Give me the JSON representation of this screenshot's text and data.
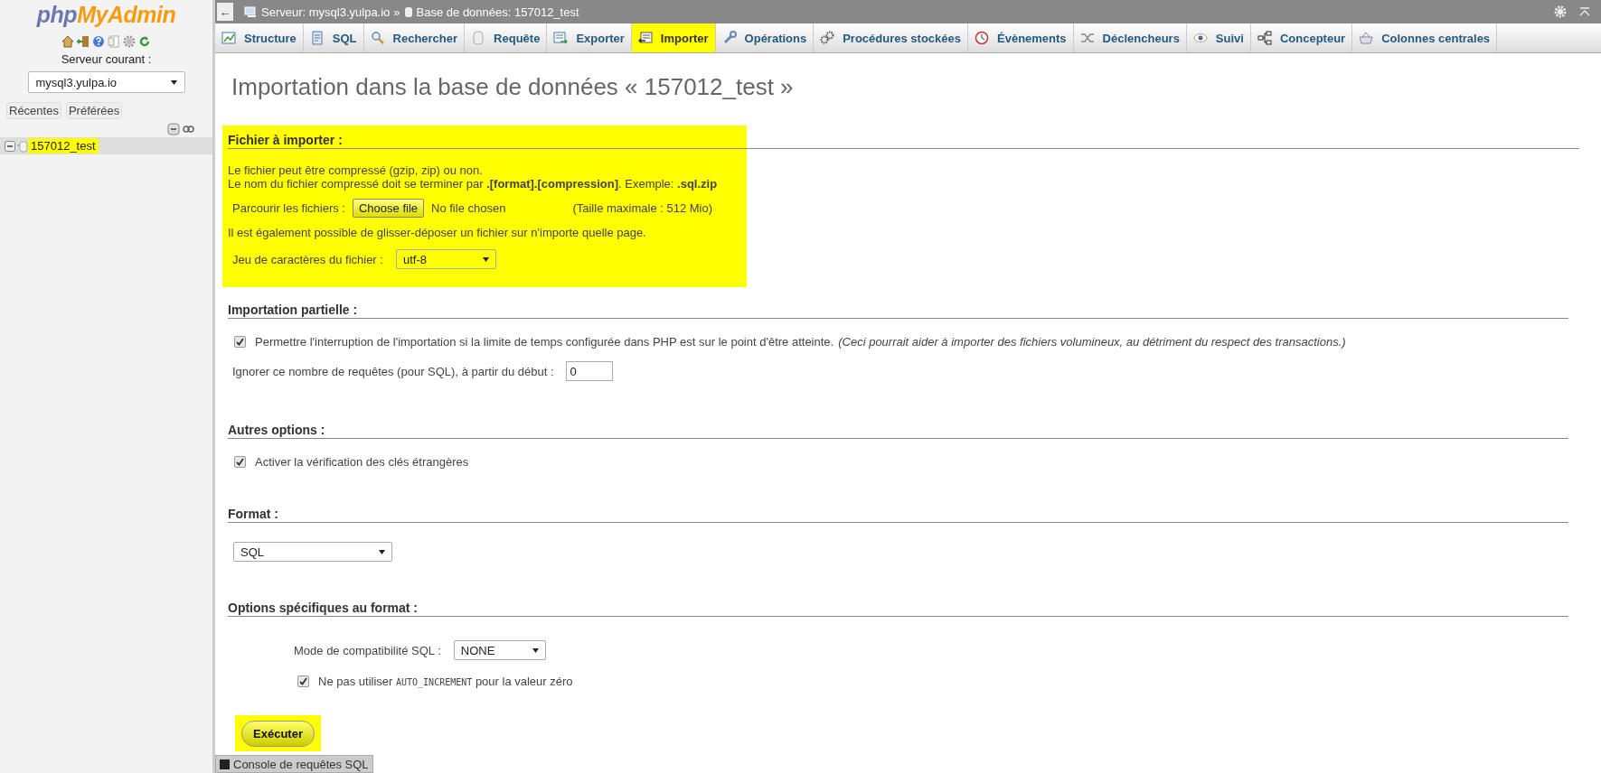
{
  "sidebar": {
    "logo_parts": [
      "php",
      "MyAdmin"
    ],
    "server_label": "Serveur courant :",
    "server_select": "mysql3.yulpa.io",
    "buttons": [
      "Récentes",
      "Préférées"
    ],
    "tree": [
      {
        "label": "157012_test",
        "expanded": true,
        "highlighted": true
      }
    ]
  },
  "breadcrumb": {
    "back": "←",
    "server": "Serveur: mysql3.yulpa.io",
    "separator": "»",
    "database": "Base de données: 157012_test"
  },
  "tabs": [
    {
      "label": "Structure",
      "selected": false
    },
    {
      "label": "SQL",
      "selected": false
    },
    {
      "label": "Rechercher",
      "selected": false
    },
    {
      "label": "Requête",
      "selected": false
    },
    {
      "label": "Exporter",
      "selected": false
    },
    {
      "label": "Importer",
      "selected": true
    },
    {
      "label": "Opérations",
      "selected": false
    },
    {
      "label": "Procédures stockées",
      "selected": false
    },
    {
      "label": "Évènements",
      "selected": false
    },
    {
      "label": "Déclencheurs",
      "selected": false
    },
    {
      "label": "Suivi",
      "selected": false
    },
    {
      "label": "Concepteur",
      "selected": false
    },
    {
      "label": "Colonnes centrales",
      "selected": false
    }
  ],
  "title": "Importation dans la base de données « 157012_test »",
  "file_section": {
    "legend": "Fichier à importer :",
    "highlighted": true,
    "hint_lines": [
      "Le fichier peut être compressé (gzip, zip) ou non.",
      "Le nom du fichier compressé doit se terminer par **.[format].[compression]**. Exemple: **.sql.zip**"
    ],
    "browse_label": "Parcourir les fichiers :",
    "choose_button": "Choose file",
    "file_status": "No file chosen",
    "max_size": "(Taille maximale : 512 Mio)",
    "drag_hint": "Il est également possible de glisser-déposer un fichier sur n'importe quelle page.",
    "charset_label": "Jeu de caractères du fichier :",
    "charset_value": "utf-8"
  },
  "partial_section": {
    "legend": "Importation partielle :",
    "allow_interrupt": {
      "checked": true,
      "label": "Permettre l'interruption de l'importation si la limite de temps configurée dans PHP est sur le point d'être atteinte.",
      "note": "(Ceci pourrait aider à importer des fichiers volumineux, au détriment du respect des transactions.)"
    },
    "skip": {
      "label": "Ignorer ce nombre de requêtes (pour SQL), à partir du début :",
      "value": "0"
    }
  },
  "other_section": {
    "legend": "Autres options :",
    "foreign_keys": {
      "checked": true,
      "label": "Activer la vérification des clés étrangères"
    }
  },
  "format_section": {
    "legend": "Format :",
    "value": "SQL"
  },
  "format_options": {
    "legend": "Options spécifiques au format :",
    "compat_label": "Mode de compatibilité SQL :",
    "compat_value": "NONE",
    "no_auto_zero": {
      "checked": true,
      "before": "Ne pas utiliser ",
      "code": "AUTO_INCREMENT",
      "after": " pour la valeur zéro"
    }
  },
  "submit": {
    "label": "Exécuter",
    "highlighted": true
  },
  "console": {
    "label": "Console de requêtes SQL"
  }
}
